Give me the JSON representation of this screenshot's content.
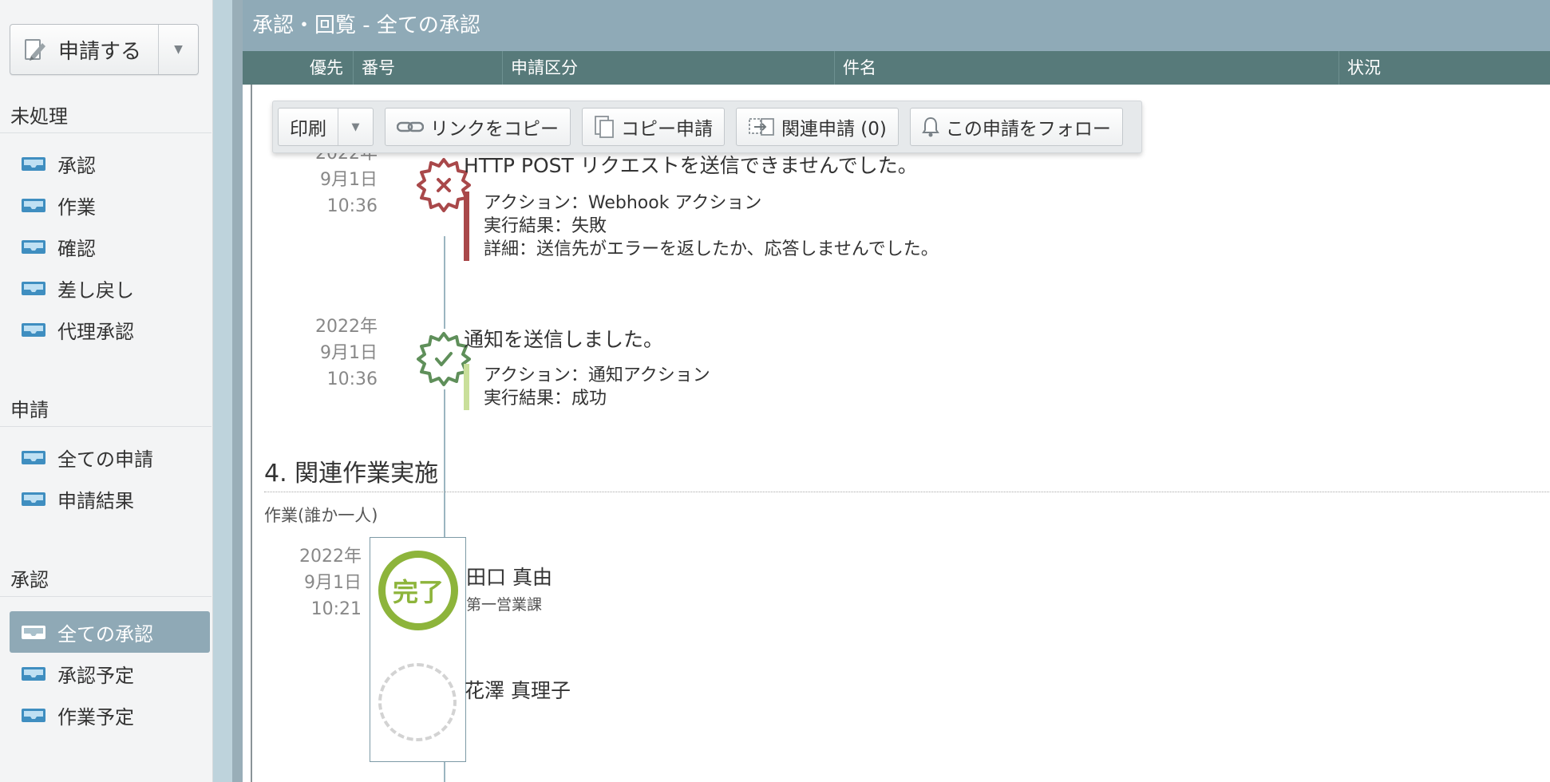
{
  "sidebar": {
    "apply_button": "申請する",
    "sections": [
      {
        "heading": "未処理",
        "items": [
          "承認",
          "作業",
          "確認",
          "差し戻し",
          "代理承認"
        ]
      },
      {
        "heading": "申請",
        "items": [
          "全ての申請",
          "申請結果"
        ]
      },
      {
        "heading": "承認",
        "items": [
          "全ての承認",
          "承認予定",
          "作業予定"
        ]
      }
    ],
    "active_item": "全ての承認"
  },
  "main": {
    "title": "承認・回覧 - 全ての承認",
    "columns": [
      "優先",
      "番号",
      "申請区分",
      "件名",
      "状況"
    ]
  },
  "toolbar": {
    "print": "印刷",
    "copy_link": "リンクをコピー",
    "copy_request": "コピー申請",
    "related_request": "関連申請 (0)",
    "follow": "この申請をフォロー"
  },
  "events": [
    {
      "date": "2022年",
      "day": "9月1日",
      "time": "10:36",
      "title": "HTTP POST リクエストを送信できませんでした。",
      "status": "error",
      "lines": [
        "アクション：Webhook アクション",
        "実行結果：失敗",
        "詳細：送信先がエラーを返したか、応答しませんでした。"
      ]
    },
    {
      "date": "2022年",
      "day": "9月1日",
      "time": "10:36",
      "title": "通知を送信しました。",
      "status": "success",
      "lines": [
        "アクション：通知アクション",
        "実行結果：成功"
      ]
    }
  ],
  "section": {
    "title": "4. 関連作業実施",
    "task_type": "作業(誰か一人)",
    "date": "2022年",
    "day": "9月1日",
    "time": "10:21",
    "done_stamp": "完了",
    "assignees": [
      {
        "name": "田口 真由",
        "dept": "第一営業課",
        "state": "done"
      },
      {
        "name": "花澤 真理子",
        "dept": "",
        "state": "pending"
      }
    ]
  },
  "colors": {
    "title_bar": "#8faab7",
    "header_bar": "#577a7a",
    "error": "#a9484a",
    "success_icon": "#5f8f5a",
    "success_bar": "#c9df9a",
    "done_stamp": "#8db43b",
    "active_nav": "#8fa9b6"
  }
}
